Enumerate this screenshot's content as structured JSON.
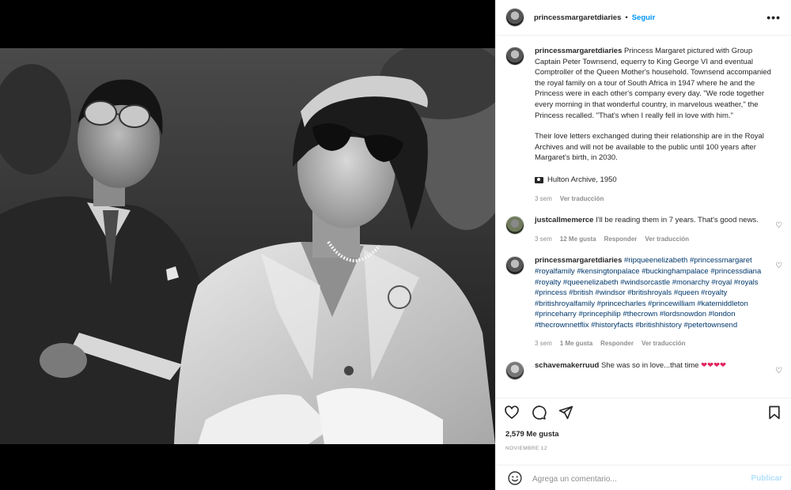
{
  "header": {
    "username": "princessmargaretdiaries",
    "separator": "•",
    "follow_label": "Seguir",
    "more_icon": "more-horizontal-icon"
  },
  "caption": {
    "username": "princessmargaretdiaries",
    "text": "Princess Margaret pictured with Group Captain Peter Townsend, equerry to King George VI and eventual Comptroller of the Queen Mother's household. Townsend accompanied the royal family on a tour of South Africa in 1947 where he and the Princess were in each other's company every day. \"We rode together every morning in that wonderful country, in marvelous weather,\" the Princess recalled. \"That's when I really fell in love with him.\"",
    "text2": "Their love letters exchanged during their relationship are in the Royal Archives and will not be available to the public until 100 years after Margaret's birth, in 2030.",
    "credit": "Hulton Archive, 1950",
    "time": "3 sem",
    "translate": "Ver traducción"
  },
  "comments": [
    {
      "username": "justcallmemerce",
      "text": "I'll be reading them in 7 years. That's good news.",
      "time": "3 sem",
      "likes": "12 Me gusta",
      "reply": "Responder",
      "translate": "Ver traducción"
    },
    {
      "username": "princessmargaretdiaries",
      "text": "#ripqueenelizabeth #princessmargaret #royalfamily #kensingtonpalace #buckinghampalace #princessdiana #royalty #queenelizabeth #windsorcastle #monarchy #royal #royals #princess #british #windsor #britishroyals #queen #royalty #britishroyalfamily #princecharles #princewilliam #katemiddleton #princeharry #princephilip #thecrown #lordsnowdon #london #thecrownnetflix #historyfacts #britishhistory #petertownsend",
      "time": "3 sem",
      "likes": "1 Me gusta",
      "reply": "Responder",
      "translate": "Ver traducción"
    },
    {
      "username": "schavemakerruud",
      "text": "She was so in love...that time",
      "hearts": "❤❤❤❤"
    }
  ],
  "actions": {
    "likes": "2,579 Me gusta",
    "date": "NOVIEMBRE 12"
  },
  "add_comment": {
    "placeholder": "Agrega un comentario...",
    "publish": "Publicar"
  },
  "colors": {
    "link_blue": "#0095f6",
    "publish_disabled": "#b2dffc",
    "hashtag": "#00376b",
    "muted": "#8e8e8e"
  }
}
